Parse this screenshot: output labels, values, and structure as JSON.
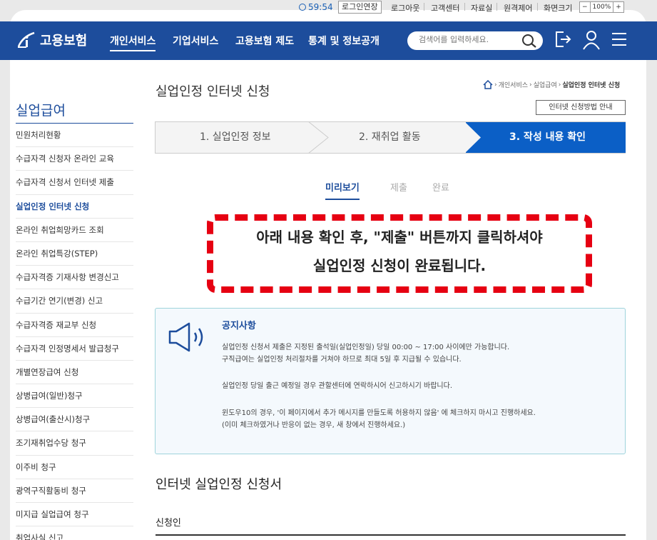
{
  "util": {
    "timer": "59:54",
    "extend_label": "로그인연장",
    "links": [
      "로그아웃",
      "고객센터",
      "자료실",
      "원격제어",
      "화면크기"
    ],
    "zoom_minus": "−",
    "zoom_value": "100%",
    "zoom_plus": "+"
  },
  "brand": {
    "logo_text": "고용보험",
    "accent": "#1d4d9c"
  },
  "gnb": {
    "menus": [
      "개인서비스",
      "기업서비스",
      "고용보험 제도",
      "통계 및 정보공개"
    ],
    "active_menu": 0,
    "search_placeholder": "검색어를 입력하세요."
  },
  "lnb": {
    "title": "실업급여",
    "items": [
      "민원처리현황",
      "수급자격 신청자 온라인 교육",
      "수급자격 신청서 인터넷 제출",
      "실업인정 인터넷 신청",
      "온라인 취업희망카드 조회",
      "온라인 취업특강(STEP)",
      "수급자격증 기재사항 변경신고",
      "수급기간 연기(변경) 신고",
      "수급자격증 재교부 신청",
      "수급자격 인정명세서 발급청구",
      "개별연장급여 신청",
      "상병급여(일반)청구",
      "상병급여(출산시)청구",
      "조기재취업수당 청구",
      "이주비 청구",
      "광역구직활동비 청구",
      "미지급 실업급여 청구",
      "취업사실 신고"
    ],
    "active_item": 3
  },
  "content": {
    "page_title": "실업인정 인터넷 신청",
    "breadcrumb": [
      "개인서비스",
      "실업급여",
      "실업인정 인터넷 신청"
    ],
    "guide_button": "인터넷 신청방법 안내",
    "steps": [
      "1. 실업인정 정보",
      "2. 재취업 활동",
      "3. 작성 내용 확인"
    ],
    "active_step": 2,
    "tabs": [
      "미리보기",
      "제출",
      "완료"
    ],
    "active_tab": 0,
    "callout": {
      "line1": "아래 내용 확인 후, \"제출\" 버튼까지 클릭하셔야",
      "line2": "실업인정 신청이 완료됩니다."
    },
    "notice": {
      "title": "공지사항",
      "lines": [
        "실업인정 신청서 제출은 지정된 출석일(실업인정일) 당일 00:00 ~ 17:00 사이에만 가능합니다.",
        "구직급여는 실업인정 처리절차를 거쳐야 하므로 최대 5일 후 지급될 수 있습니다.",
        "실업인정 당일 출근 예정일 경우 관할센터에 연락하시어 신고하시기 바랍니다.",
        "윈도우10의 경우, '이 페이지에서 추가 메시지를 만들도록 허용하지 않음' 에 체크하지 마시고 진행하세요.",
        "(이미 체크하였거나 반응이 없는 경우, 새 창에서 진행하세요.)"
      ]
    },
    "section_title": "인터넷 실업인정 신청서",
    "subsection_title": "신청인"
  }
}
